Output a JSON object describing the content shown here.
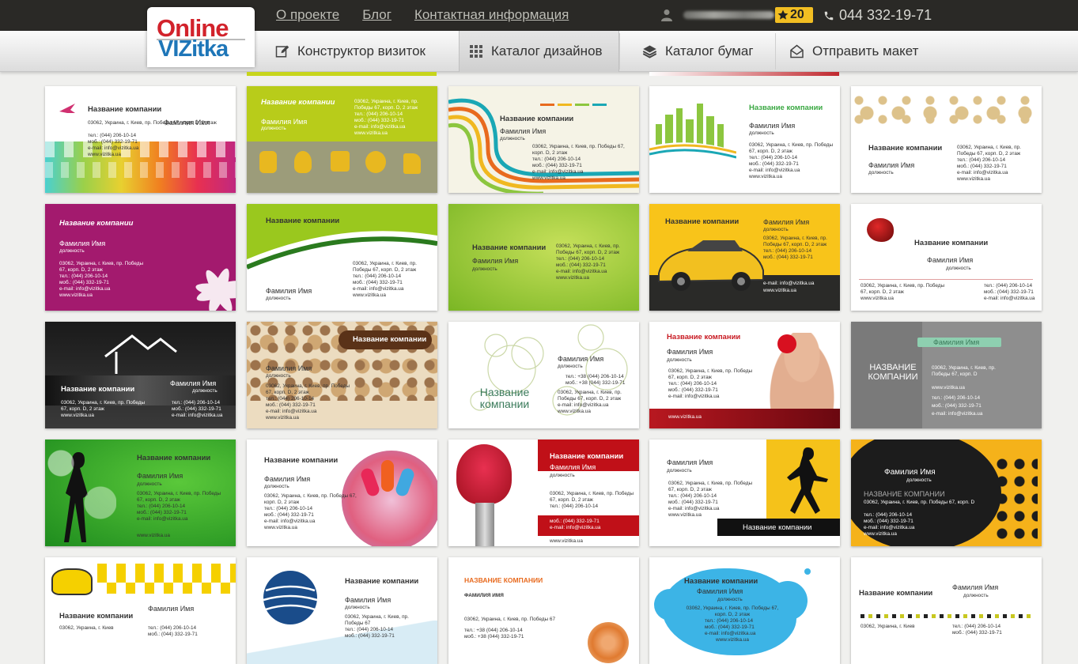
{
  "header": {
    "top_links": [
      "О проекте",
      "Блог",
      "Контактная информация"
    ],
    "rating": "20",
    "phone": "044 332-19-71"
  },
  "logo": {
    "line1": "Online",
    "line2": "VIZitka"
  },
  "nav": [
    {
      "label": "Конструктор визиток",
      "icon": "pencil-icon"
    },
    {
      "label": "Каталог дизайнов",
      "icon": "grid-icon",
      "active": true
    },
    {
      "label": "Каталог бумаг",
      "icon": "layers-icon"
    },
    {
      "label": "Отправить макет",
      "icon": "envelope-icon"
    }
  ],
  "colors": {
    "accent_yellow": "#f2be22",
    "topbar": "#2a2926",
    "brand_red": "#d2222b",
    "brand_blue": "#1e76b8"
  },
  "cards": [
    {
      "company": "Название компании",
      "name": "Фамилия Имя",
      "position": "",
      "address": "03062, Украина, г. Киев, пр. Победы 67, корп. D, 2 этаж",
      "phone1": "тел.: (044) 206-10-14",
      "phone2": "моб.: (044) 332-19-71",
      "email": "e-mail: info@vizitka.ua",
      "web": "www.vizitka.ua"
    },
    {
      "company": "Название компании",
      "name": "Фамилия Имя",
      "position": "должность",
      "address": "03062, Украина, г. Киев, пр. Победы 67, корп. D, 2 этаж",
      "phone1": "тел.: (044) 206-10-14",
      "phone2": "моб.: (044) 332-19-71",
      "email": "e-mail: info@vizitka.ua",
      "web": "www.vizitka.ua"
    },
    {
      "company": "Название компании",
      "name": "Фамилия Имя",
      "position": "должность",
      "address": "03062, Украина, г. Киев, пр. Победы 67, корп. D, 2 этаж",
      "phone1": "тел.: (044) 206-10-14",
      "phone2": "моб.: (044) 332-19-71",
      "email": "e-mail: info@vizitka.ua",
      "web": "www.vizitka.ua"
    },
    {
      "company": "Название компании",
      "name": "Фамилия Имя",
      "position": "должность",
      "address": "03062, Украина, г. Киев, пр. Победы 67, корп. D, 2 этаж",
      "phone1": "тел.: (044) 206-10-14",
      "phone2": "моб.: (044) 332-19-71",
      "email": "e-mail: info@vizitka.ua",
      "web": "www.vizitka.ua"
    },
    {
      "company": "Название компании",
      "name": "Фамилия Имя",
      "position": "должность",
      "address": "03062, Украина, г. Киев, пр. Победы 67, корп. D, 2 этаж",
      "phone1": "тел.: (044) 206-10-14",
      "phone2": "моб.: (044) 332-19-71",
      "email": "e-mail: info@vizitka.ua",
      "web": "www.vizitka.ua"
    },
    {
      "company": "Название компании",
      "name": "Фамилия Имя",
      "position": "должность",
      "address": "03062, Украина, г. Киев, пр. Победы 67, корп. D, 2 этаж",
      "phone1": "тел.: (044) 206-10-14",
      "phone2": "моб.: (044) 332-19-71",
      "email": "e-mail: info@vizitka.ua",
      "web": "www.vizitka.ua"
    },
    {
      "company": "Название компании",
      "name": "Фамилия Имя",
      "position": "должность",
      "address": "03062, Украина, г. Киев, пр. Победы 67, корп. D, 2 этаж",
      "phone1": "тел.: (044) 206-10-14",
      "phone2": "моб.: (044) 332-19-71",
      "email": "e-mail: info@vizitka.ua",
      "web": "www.vizitka.ua"
    },
    {
      "company": "Название компании",
      "name": "Фамилия Имя",
      "position": "должность",
      "address": "03062, Украина, г. Киев, пр. Победы 67, корп. D, 2 этаж",
      "phone1": "тел.: (044) 206-10-14",
      "phone2": "моб.: (044) 332-19-71",
      "email": "e-mail: info@vizitka.ua",
      "web": "www.vizitka.ua"
    },
    {
      "company": "Название компании",
      "name": "Фамилия Имя",
      "position": "должность",
      "address": "03062, Украина, г. Киев, пр. Победы 67, корп. D, 2 этаж",
      "phone1": "тел.: (044) 206-10-14",
      "phone2": "моб.: (044) 332-19-71",
      "email": "e-mail: info@vizitka.ua",
      "web": "www.vizitka.ua"
    },
    {
      "company": "Название компании",
      "name": "Фамилия Имя",
      "position": "должность",
      "address": "03062, Украина, г. Киев, пр. Победы 67, корп. D, 2 этаж",
      "phone1": "тел.: (044) 206-10-14",
      "phone2": "моб.: (044) 332-19-71",
      "email": "e-mail: info@vizitka.ua",
      "web": "www.vizitka.ua"
    },
    {
      "company": "Название компании",
      "name": "Фамилия Имя",
      "position": "должность",
      "address": "03062, Украина, г. Киев, пр. Победы 67, корп. D, 2 этаж",
      "phone1": "тел.: (044) 206-10-14",
      "phone2": "моб.: (044) 332-19-71",
      "email": "e-mail: info@vizitka.ua",
      "web": "www.vizitka.ua"
    },
    {
      "company": "Название компании",
      "name": "Фамилия Имя",
      "position": "должность",
      "address": "03062, Украина, г. Киев, пр. Победы 67, корп. D, 2 этаж",
      "phone1": "тел.: (044) 206-10-14",
      "phone2": "моб.: (044) 332-19-71",
      "email": "e-mail: info@vizitka.ua",
      "web": "www.vizitka.ua"
    },
    {
      "company": "Название компании",
      "name": "Фамилия Имя",
      "position": "должность",
      "address": "03062, Украина, г. Киев, пр. Победы 67, корп. D, 2 этаж",
      "phone1": "тел.: +38 (044) 206-10-14",
      "phone2": "моб.: +38 (044) 332-19-71",
      "email": "e-mail: info@vizitka.ua",
      "web": "www.vizitka.ua"
    },
    {
      "company": "Название компании",
      "name": "Фамилия Имя",
      "position": "должность",
      "address": "03062, Украина, г. Киев, пр. Победы 67, корп. D, 2 этаж",
      "phone1": "тел.: (044) 206-10-14",
      "phone2": "моб.: (044) 332-19-71",
      "email": "e-mail: info@vizitka.ua",
      "web": "www.vizitka.ua"
    },
    {
      "company": "НАЗВАНИЕ КОМПАНИИ",
      "name": "Фамилия Имя",
      "position": "",
      "address": "03062, Украина, г. Киев, пр. Победы 67, корп. D",
      "phone1": "тел.: (044) 206-10-14",
      "phone2": "моб.: (044) 332-19-71",
      "email": "e-mail: info@vizitka.ua",
      "web": "www.vizitka.ua"
    },
    {
      "company": "Название компании",
      "name": "Фамилия Имя",
      "position": "должность",
      "address": "03062, Украина, г. Киев, пр. Победы 67, корп. D, 2 этаж",
      "phone1": "тел.: (044) 206-10-14",
      "phone2": "моб.: (044) 332-19-71",
      "email": "e-mail: info@vizitka.ua",
      "web": "www.vizitka.ua"
    },
    {
      "company": "Название компании",
      "name": "Фамилия Имя",
      "position": "должность",
      "address": "03062, Украина, г. Киев, пр. Победы 67, корп. D, 2 этаж",
      "phone1": "тел.: (044) 206-10-14",
      "phone2": "моб.: (044) 332-19-71",
      "email": "e-mail: info@vizitka.ua",
      "web": "www.vizitka.ua"
    },
    {
      "company": "Название компании",
      "name": "Фамилия Имя",
      "position": "должность",
      "address": "03062, Украина, г. Киев, пр. Победы 67, корп. D, 2 этаж",
      "phone1": "тел.: (044) 206-10-14",
      "phone2": "моб.: (044) 332-19-71",
      "email": "e-mail: info@vizitka.ua",
      "web": "www.vizitka.ua"
    },
    {
      "company": "Название компании",
      "name": "Фамилия Имя",
      "position": "должность",
      "address": "03062, Украина, г. Киев, пр. Победы 67, корп. D, 2 этаж",
      "phone1": "тел.: (044) 206-10-14",
      "phone2": "моб.: (044) 332-19-71",
      "email": "e-mail: info@vizitka.ua",
      "web": "www.vizitka.ua"
    },
    {
      "company": "НАЗВАНИЕ КОМПАНИИ",
      "name": "Фамилия Имя",
      "position": "должность",
      "address": "03062, Украина, г. Киев, пр. Победы 67, корп. D",
      "phone1": "тел.: (044) 206-10-14",
      "phone2": "моб.: (044) 332-19-71",
      "email": "e-mail: info@vizitka.ua",
      "web": "www.vizitka.ua"
    },
    {
      "company": "Название компании",
      "name": "Фамилия Имя",
      "position": "",
      "address": "03062, Украина, г. Киев",
      "phone1": "тел.: (044) 206-10-14",
      "phone2": "моб.: (044) 332-19-71",
      "email": "",
      "web": ""
    },
    {
      "company": "Название компании",
      "name": "Фамилия Имя",
      "position": "должность",
      "address": "03062, Украина, г. Киев, пр. Победы 67",
      "phone1": "тел.: (044) 206-10-14",
      "phone2": "моб.: (044) 332-19-71",
      "email": "",
      "web": ""
    },
    {
      "company": "НАЗВАНИЕ КОМПАНИИ",
      "name": "ФАМИЛИЯ ИМЯ",
      "position": "",
      "address": "03062, Украина, г. Киев, пр. Победы 67",
      "phone1": "тел.: +38 (044) 206-10-14",
      "phone2": "моб.: +38 (044) 332-19-71",
      "email": "",
      "web": ""
    },
    {
      "company": "Название компании",
      "name": "Фамилия Имя",
      "position": "должность",
      "address": "03062, Украина, г. Киев, пр. Победы 67, корп. D, 2 этаж",
      "phone1": "тел.: (044) 206-10-14",
      "phone2": "моб.: (044) 332-19-71",
      "email": "e-mail: info@vizitka.ua",
      "web": "www.vizitka.ua"
    },
    {
      "company": "Название компании",
      "name": "Фамилия Имя",
      "position": "должность",
      "address": "03062, Украина, г. Киев",
      "phone1": "тел.: (044) 206-10-14",
      "phone2": "моб.: (044) 332-19-71",
      "email": "",
      "web": ""
    }
  ]
}
